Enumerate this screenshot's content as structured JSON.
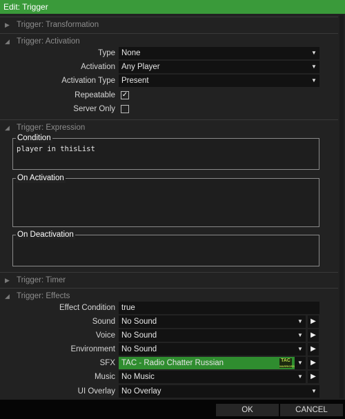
{
  "window": {
    "title": "Edit: Trigger"
  },
  "sections": {
    "transformation": "Trigger: Transformation",
    "activation": "Trigger: Activation",
    "expression": "Trigger: Expression",
    "timer": "Trigger: Timer",
    "effects": "Trigger: Effects"
  },
  "activation": {
    "type": {
      "label": "Type",
      "value": "None"
    },
    "activation": {
      "label": "Activation",
      "value": "Any Player"
    },
    "activation_type": {
      "label": "Activation Type",
      "value": "Present"
    },
    "repeatable": {
      "label": "Repeatable",
      "checked": true
    },
    "server_only": {
      "label": "Server Only",
      "checked": false
    }
  },
  "expression": {
    "condition": {
      "label": "Condition",
      "value": "player in thisList"
    },
    "on_activation": {
      "label": "On Activation",
      "value": ""
    },
    "on_deactivation": {
      "label": "On Deactivation",
      "value": ""
    }
  },
  "effects": {
    "effect_condition": {
      "label": "Effect Condition",
      "value": "true"
    },
    "sound": {
      "label": "Sound",
      "value": "No Sound"
    },
    "voice": {
      "label": "Voice",
      "value": "No Sound"
    },
    "environment": {
      "label": "Environment",
      "value": "No Sound"
    },
    "sfx": {
      "label": "SFX",
      "value": "TAC - Radio Chatter Russian",
      "badge_top": "TAC",
      "badge_bottom": "WARRIORS"
    },
    "music": {
      "label": "Music",
      "value": "No Music"
    },
    "ui_overlay": {
      "label": "UI Overlay",
      "value": "No Overlay"
    }
  },
  "buttons": {
    "ok": "OK",
    "cancel": "CANCEL"
  },
  "colors": {
    "title_bar": "#3a9a3a",
    "sfx_highlight": "#2f8d2f",
    "panel": "#222222"
  },
  "icons": {
    "collapsed": "triangle-right-icon",
    "expanded": "triangle-down-icon",
    "dropdown": "chevron-down-icon",
    "play": "play-icon"
  }
}
